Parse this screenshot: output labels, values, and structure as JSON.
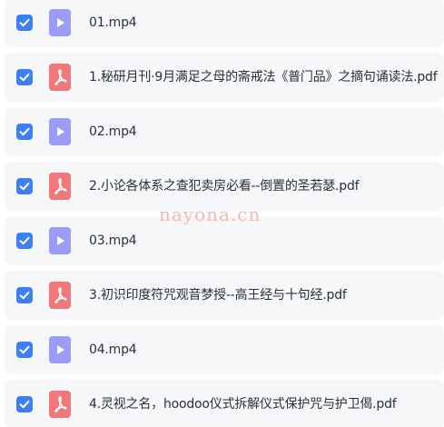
{
  "files": [
    {
      "name": "01.mp4",
      "type": "video",
      "icon": "video-file-icon",
      "checked": true
    },
    {
      "name": "1.秘研月刊·9月满足之母的斋戒法《普门品》之摘句诵读法.pdf",
      "type": "pdf",
      "icon": "pdf-file-icon",
      "checked": true
    },
    {
      "name": "02.mp4",
      "type": "video",
      "icon": "video-file-icon",
      "checked": true
    },
    {
      "name": "2.小论各体系之查犯卖房必看--倒置的圣若瑟.pdf",
      "type": "pdf",
      "icon": "pdf-file-icon",
      "checked": true
    },
    {
      "name": "03.mp4",
      "type": "video",
      "icon": "video-file-icon",
      "checked": true
    },
    {
      "name": "3.初识印度符咒观音梦授--高王经与十句经.pdf",
      "type": "pdf",
      "icon": "pdf-file-icon",
      "checked": true
    },
    {
      "name": "04.mp4",
      "type": "video",
      "icon": "video-file-icon",
      "checked": true
    },
    {
      "name": "4.灵视之名，hoodoo仪式拆解仪式保护咒与护卫偈.pdf",
      "type": "pdf",
      "icon": "pdf-file-icon",
      "checked": true
    }
  ],
  "watermark": "nayona.cn",
  "colors": {
    "checkbox": "#3d7ff6",
    "video_icon": "#9b9cf5",
    "pdf_icon": "#f0787a",
    "row_background": "#f6f7f9",
    "watermark": "#f2b8b5"
  }
}
